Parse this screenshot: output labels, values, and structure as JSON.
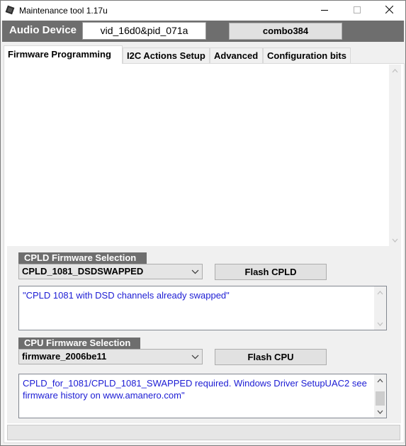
{
  "window": {
    "title": "Maintenance tool 1.17u",
    "icons": {
      "app": "chip-icon",
      "minimize": "minimize-icon",
      "maximize": "maximize-icon",
      "close": "close-icon"
    }
  },
  "device": {
    "label": "Audio Device",
    "id": "vid_16d0&pid_071a",
    "combo_button": "combo384"
  },
  "tabs": [
    {
      "label": "Firmware Programming",
      "active": true
    },
    {
      "label": "I2C Actions Setup",
      "active": false
    },
    {
      "label": "Advanced",
      "active": false
    },
    {
      "label": "Configuration bits",
      "active": false
    }
  ],
  "cpld": {
    "group_title": "CPLD Firmware Selection",
    "selected": "CPLD_1081_DSDSWAPPED",
    "flash_button": "Flash CPLD",
    "description": "\"CPLD 1081 with DSD channels already swapped\""
  },
  "cpu": {
    "group_title": "CPU Firmware Selection",
    "selected": "firmware_2006be11",
    "flash_button": "Flash CPU",
    "description": "CPLD_for_1081/CPLD_1081_SWAPPED required. Windows Driver SetupUAC2 see firmware history on www.amanero.com\""
  },
  "colors": {
    "header_bg": "#6e6e6e",
    "memo_text": "#1c1cd4"
  }
}
